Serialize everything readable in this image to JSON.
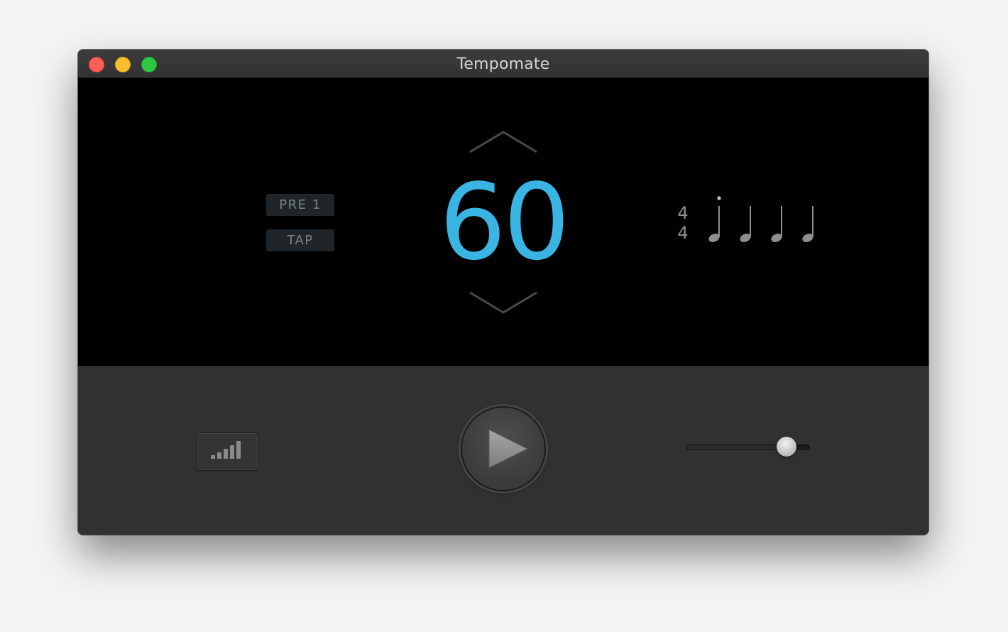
{
  "window": {
    "title": "Tempomate"
  },
  "display": {
    "preset_label": "PRE 1",
    "tap_label": "TAP",
    "bpm": "60",
    "bpm_color": "#3ab5e3",
    "time_signature": {
      "numerator": "4",
      "denominator": "4"
    },
    "beat_count": 4,
    "active_beat": 1,
    "icons": {
      "increase": "chevron-up-icon",
      "decrease": "chevron-down-icon",
      "beat": "quarter-note-icon"
    }
  },
  "controls": {
    "sound_icon": "signal-bars-icon",
    "play_icon": "play-icon",
    "volume_fraction": 0.81
  },
  "colors": {
    "close": "#fd5e55",
    "minimize": "#f5be2e",
    "maximize": "#2ec840"
  }
}
